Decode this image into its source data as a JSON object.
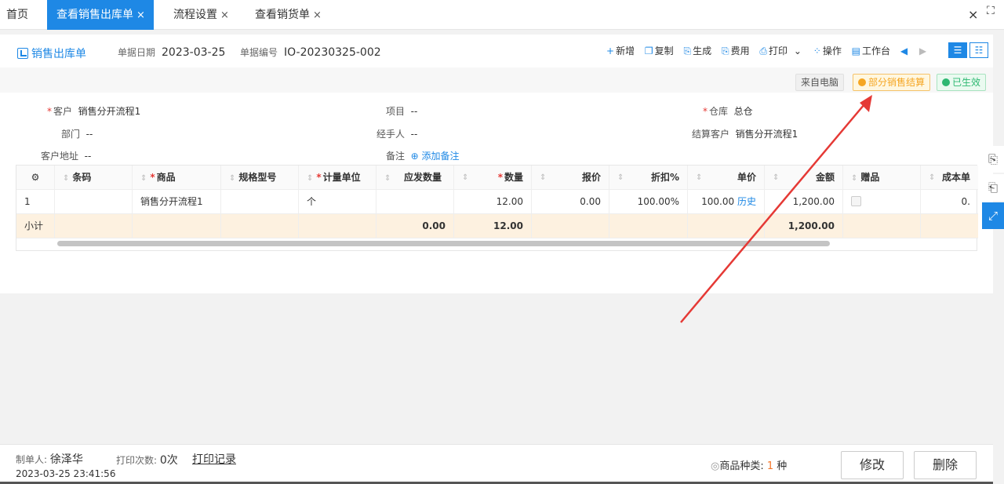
{
  "tabs": [
    {
      "label": "首页"
    },
    {
      "label": "查看销售出库单",
      "close": "×"
    },
    {
      "label": "流程设置",
      "close": "×"
    },
    {
      "label": "查看销货单",
      "close": "×"
    }
  ],
  "window_close": "×",
  "window_full": "⛶",
  "doc": {
    "title": "销售出库单",
    "date_label": "单据日期",
    "date_value": "2023-03-25",
    "no_label": "单据编号",
    "no_value": "IO-20230325-002"
  },
  "toolbar": [
    {
      "glyph": "+",
      "label": "新增"
    },
    {
      "glyph": "❐",
      "label": "复制"
    },
    {
      "glyph": "⎘",
      "label": "生成"
    },
    {
      "glyph": "⎘",
      "label": "费用"
    },
    {
      "glyph": "⎙",
      "label": "打印"
    },
    {
      "glyph": "⌄",
      "label": ""
    },
    {
      "glyph": "⁘",
      "label": "操作"
    },
    {
      "glyph": "▤",
      "label": "工作台"
    },
    {
      "glyph": "◀",
      "label": ""
    },
    {
      "glyph": "▶",
      "label": ""
    }
  ],
  "view_toggle": [
    "☰",
    "☷"
  ],
  "badges": {
    "source": "来自电脑",
    "settle": "部分销售结算",
    "status": "已生效"
  },
  "fields": {
    "customer": {
      "label": "客户",
      "value": "销售分开流程1"
    },
    "project": {
      "label": "项目",
      "value": "--"
    },
    "warehouse": {
      "label": "仓库",
      "value": "总仓"
    },
    "dept": {
      "label": "部门",
      "value": "--"
    },
    "handler": {
      "label": "经手人",
      "value": "--"
    },
    "settle_customer": {
      "label": "结算客户",
      "value": "销售分开流程1"
    },
    "address": {
      "label": "客户地址",
      "value": "--"
    },
    "remark": {
      "label": "备注",
      "value": "添加备注"
    }
  },
  "grid": {
    "headers": [
      "条码",
      "商品",
      "规格型号",
      "计量单位",
      "应发数量",
      "数量",
      "报价",
      "折扣%",
      "单价",
      "金额",
      "赠品",
      "成本单"
    ],
    "row": {
      "index": "1",
      "barcode": "",
      "product": "销售分开流程1",
      "spec": "",
      "unit": "个",
      "should": "",
      "qty": "12.00",
      "quote": "0.00",
      "discount": "100.00%",
      "price": "100.00",
      "history": "历史",
      "amount": "1,200.00",
      "gift": "",
      "cost": "0."
    },
    "subtotal": {
      "label": "小计",
      "should": "0.00",
      "qty": "12.00",
      "amount": "1,200.00"
    }
  },
  "right_panel": [
    "⎘",
    "⎗",
    "⤢"
  ],
  "footer": {
    "maker_label": "制单人:",
    "maker": "徐泽华",
    "time": "2023-03-25 23:41:56",
    "print_label": "打印次数:",
    "print_count": "0次",
    "print_record": "打印记录",
    "kinds_label": "商品种类:",
    "kinds_value": "1",
    "kinds_unit": "种",
    "edit": "修改",
    "delete": "删除"
  },
  "colors": {
    "accent": "#1e88e5",
    "annotation_arrow": "#e53935"
  }
}
